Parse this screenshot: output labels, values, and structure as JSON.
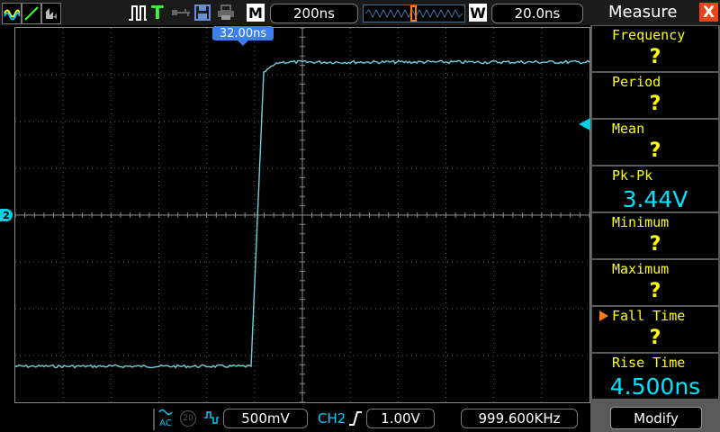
{
  "toolbar": {
    "trigger_mode_label": "T",
    "memory_label": "M",
    "timebase_value": "200ns",
    "window_label": "W",
    "window_value": "20.0ns"
  },
  "screen": {
    "time_marker": "32.00ns",
    "channel_marker": "2"
  },
  "bottombar": {
    "coupling": "AC",
    "bw_limit": "20",
    "volts_div": "500mV",
    "trigger_channel": "CH2",
    "trigger_level": "1.00V",
    "frequency": "999.600KHz"
  },
  "measure": {
    "title": "Measure",
    "close_label": "X",
    "items": [
      {
        "label": "Frequency",
        "value": "?"
      },
      {
        "label": "Period",
        "value": "?"
      },
      {
        "label": "Mean",
        "value": "?"
      },
      {
        "label": "Pk-Pk",
        "value": "3.44V"
      },
      {
        "label": "Minimum",
        "value": "?"
      },
      {
        "label": "Maximum",
        "value": "?"
      },
      {
        "label": "Fall Time",
        "value": "?",
        "selected": true
      },
      {
        "label": "Rise Time",
        "value": "4.500ns"
      }
    ],
    "modify_label": "Modify"
  },
  "colors": {
    "trace": "#6fd0dc",
    "accent_yellow": "#ffff00",
    "value_cyan": "#00e5ff",
    "marker_blue": "#3b7ff0",
    "close_red": "#e8441a"
  }
}
